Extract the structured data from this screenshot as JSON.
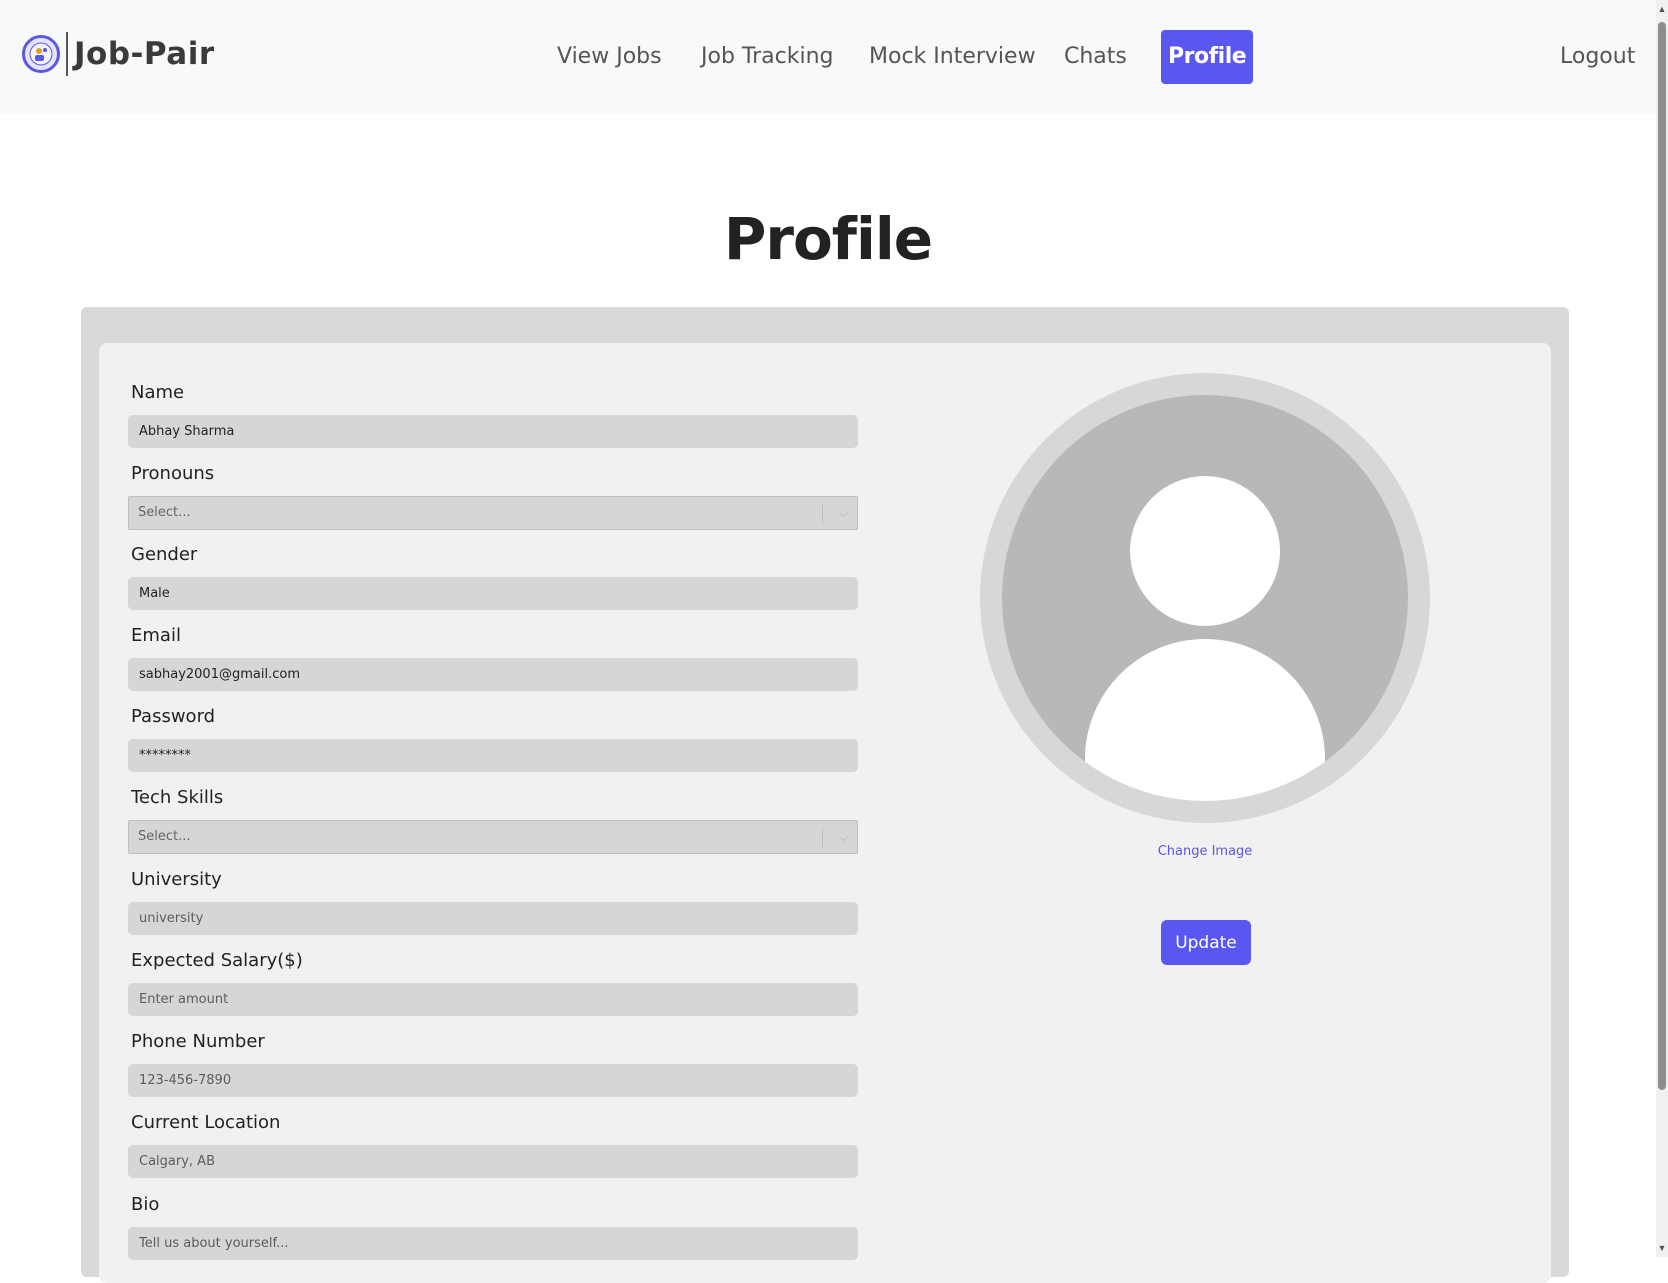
{
  "app": {
    "brand_name": "Job-Pair"
  },
  "nav": {
    "items": [
      {
        "label": "View Jobs",
        "active": false
      },
      {
        "label": "Job Tracking",
        "active": false
      },
      {
        "label": "Mock Interview",
        "active": false
      },
      {
        "label": "Chats",
        "active": false
      },
      {
        "label": "Profile",
        "active": true
      }
    ],
    "logout_label": "Logout"
  },
  "page": {
    "title": "Profile"
  },
  "form": {
    "name": {
      "label": "Name",
      "value": "Abhay Sharma"
    },
    "pronouns": {
      "label": "Pronouns",
      "placeholder": "Select..."
    },
    "gender": {
      "label": "Gender",
      "value": "Male"
    },
    "email": {
      "label": "Email",
      "value": "sabhay2001@gmail.com"
    },
    "password": {
      "label": "Password",
      "value": "********"
    },
    "tech_skills": {
      "label": "Tech Skills",
      "placeholder": "Select..."
    },
    "university": {
      "label": "University",
      "placeholder": "university"
    },
    "expected_salary": {
      "label": "Expected Salary($)",
      "placeholder": "Enter amount"
    },
    "phone": {
      "label": "Phone Number",
      "placeholder": "123-456-7890"
    },
    "location": {
      "label": "Current Location",
      "placeholder": "Calgary, AB"
    },
    "bio": {
      "label": "Bio",
      "placeholder": "Tell us about yourself..."
    }
  },
  "avatar": {
    "change_label": "Change Image"
  },
  "actions": {
    "update_label": "Update"
  },
  "colors": {
    "accent": "#5a57f0",
    "card_outer": "#d9d9d9",
    "card_inner": "#f1f1f1",
    "input_bg": "#d6d6d6"
  }
}
